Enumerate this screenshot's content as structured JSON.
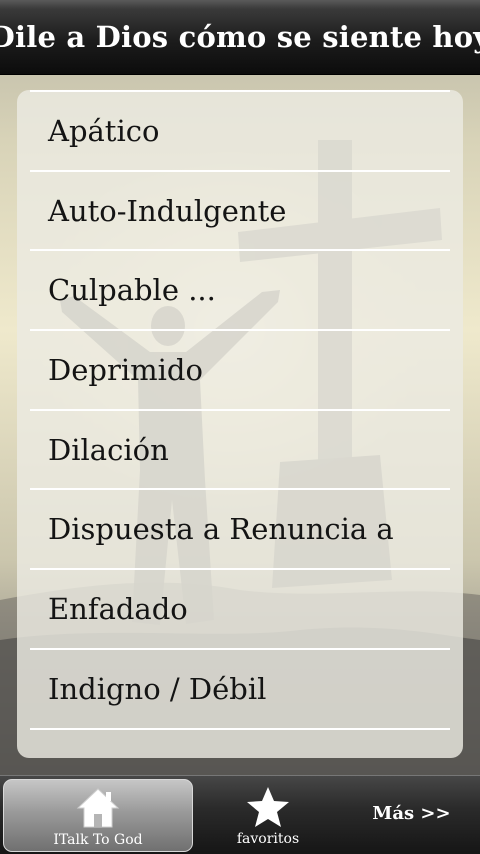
{
  "header": {
    "title": "Dile a Dios cómo se siente hoy"
  },
  "feelings": {
    "items": [
      "Apático",
      "Auto-Indulgente",
      "Culpable ...",
      "Deprimido",
      "Dilación",
      "Dispuesta a Renuncia a",
      "Enfadado",
      "Indigno / Débil"
    ]
  },
  "tabbar": {
    "tabs": [
      {
        "label": "ITalk To God",
        "icon": "home-icon",
        "active": true
      },
      {
        "label": "favoritos",
        "icon": "star-icon",
        "active": false
      },
      {
        "label": "Más >>",
        "icon": "",
        "active": false
      }
    ]
  },
  "colors": {
    "titlebar": "#1c1c1c",
    "title_text": "#ffffff",
    "list_text": "#141414",
    "divider": "#ffffff",
    "active_tab": "#9a9a9a"
  }
}
